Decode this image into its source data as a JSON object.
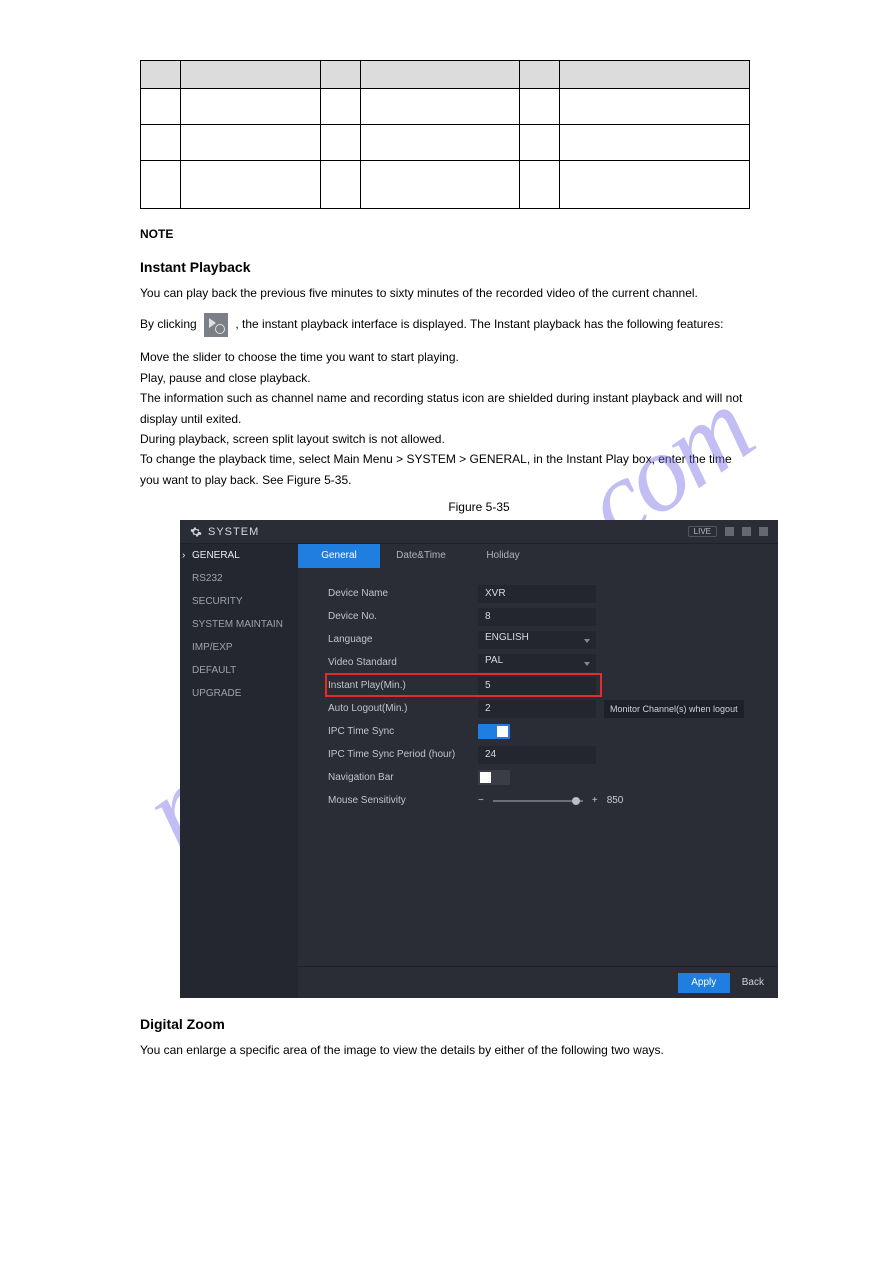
{
  "watermark": "manualshive.com",
  "page_header": {
    "section_1_title": "Instant Playback",
    "p1_a": "You can play back the previous five minutes to sixty minutes of the recorded video of the current channel.",
    "p1_b_prefix": "By clicking ",
    "p1_b_suffix": ", the instant playback interface is displayed. The Instant playback has the following features:",
    "bullets": [
      "Move the slider to choose the time you want to start playing.",
      "Play, pause and close playback.",
      "The information such as channel name and recording status icon are shielded during instant playback and will not display until exited.",
      "During playback, screen split layout switch is not allowed.",
      "To change the playback time, select Main Menu > SYSTEM > GENERAL, in the Instant Play box, enter the time you want to play back. See Figure 5-35."
    ],
    "figure_caption": "Figure 5-35",
    "section_2_title": "Digital Zoom",
    "p2": "You can enlarge a specific area of the image to view the details by either of the following two ways.",
    "note_label": "NOTE"
  },
  "screenshot": {
    "title": "SYSTEM",
    "live_badge": "LIVE",
    "sidebar": [
      {
        "label": "GENERAL",
        "active": true
      },
      {
        "label": "RS232",
        "active": false
      },
      {
        "label": "SECURITY",
        "active": false
      },
      {
        "label": "SYSTEM MAINTAIN",
        "active": false
      },
      {
        "label": "IMP/EXP",
        "active": false
      },
      {
        "label": "DEFAULT",
        "active": false
      },
      {
        "label": "UPGRADE",
        "active": false
      }
    ],
    "tabs": [
      {
        "label": "General",
        "active": true
      },
      {
        "label": "Date&Time",
        "active": false
      },
      {
        "label": "Holiday",
        "active": false
      }
    ],
    "form": {
      "device_name_label": "Device Name",
      "device_name_value": "XVR",
      "device_no_label": "Device No.",
      "device_no_value": "8",
      "language_label": "Language",
      "language_value": "ENGLISH",
      "video_std_label": "Video Standard",
      "video_std_value": "PAL",
      "instant_play_label": "Instant Play(Min.)",
      "instant_play_value": "5",
      "auto_logout_label": "Auto Logout(Min.)",
      "auto_logout_value": "2",
      "monitor_btn": "Monitor Channel(s) when logout",
      "ipc_sync_label": "IPC Time Sync",
      "ipc_sync_on": true,
      "ipc_period_label": "IPC Time Sync Period (hour)",
      "ipc_period_value": "24",
      "nav_bar_label": "Navigation Bar",
      "nav_bar_on": false,
      "mouse_label": "Mouse Sensitivity",
      "mouse_minus": "−",
      "mouse_plus": "+",
      "mouse_value": "850"
    },
    "apply": "Apply",
    "back": "Back"
  }
}
